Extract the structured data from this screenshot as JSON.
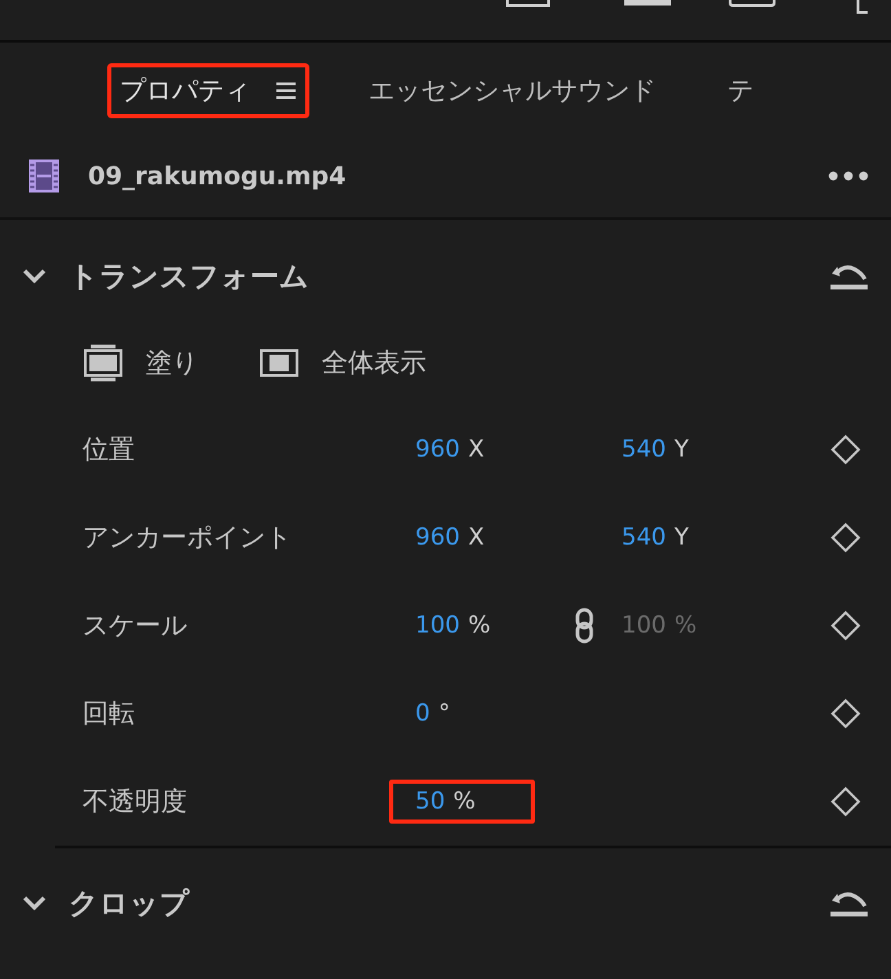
{
  "tabs": [
    {
      "label": "プロパティ",
      "selected": true,
      "highlighted": true,
      "menu": true
    },
    {
      "label": "エッセンシャルサウンド",
      "selected": false,
      "highlighted": false,
      "menu": false
    },
    {
      "label": "テ",
      "selected": false,
      "highlighted": false,
      "menu": false
    }
  ],
  "clip": {
    "name": "09_rakumogu.mp4"
  },
  "sections": [
    {
      "title": "トランスフォーム",
      "kind": "transform",
      "fit_buttons": [
        {
          "label": "塗り",
          "kind": "fill"
        },
        {
          "label": "全体表示",
          "kind": "fit"
        }
      ],
      "properties": [
        {
          "label": "位置",
          "kind": "pair",
          "value1": "960",
          "unit1": "X",
          "value2": "540",
          "unit2": "Y",
          "linked": false,
          "disabled2": false,
          "highlighted": false
        },
        {
          "label": "アンカーポイント",
          "kind": "pair",
          "value1": "960",
          "unit1": "X",
          "value2": "540",
          "unit2": "Y",
          "linked": false,
          "disabled2": false,
          "highlighted": false
        },
        {
          "label": "スケール",
          "kind": "pair",
          "value1": "100",
          "unit1": "%",
          "value2": "100",
          "unit2": "%",
          "linked": true,
          "disabled2": true,
          "highlighted": false
        },
        {
          "label": "回転",
          "kind": "single",
          "value1": "0",
          "unit1": "°",
          "highlighted": false
        },
        {
          "label": "不透明度",
          "kind": "single",
          "value1": "50",
          "unit1": "%",
          "highlighted": true
        }
      ]
    },
    {
      "title": "クロップ",
      "kind": "collapsed"
    }
  ]
}
